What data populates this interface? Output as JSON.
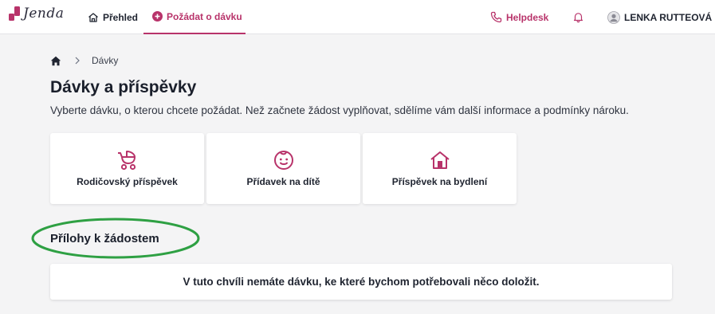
{
  "header": {
    "logo_text": "Jenda",
    "nav": {
      "overview": "Přehled",
      "request_benefit": "Požádat o dávku",
      "helpdesk": "Helpdesk",
      "user_name": "LENKA RUTTEOVÁ"
    }
  },
  "breadcrumb": {
    "current": "Dávky"
  },
  "page": {
    "title": "Dávky a příspěvky",
    "description": "Vyberte dávku, o kterou chcete požádat. Než začnete žádost vyplňovat, sdělíme vám další informace a podmínky nároku."
  },
  "benefits": [
    {
      "label": "Rodičovský příspěvek",
      "icon": "stroller-icon"
    },
    {
      "label": "Přídavek na dítě",
      "icon": "child-face-icon"
    },
    {
      "label": "Příspěvek na bydlení",
      "icon": "house-icon"
    }
  ],
  "attachments": {
    "title": "Přílohy k žádostem",
    "empty_message": "V tuto chvíli nemáte dávku, ke které bychom potřebovali něco doložit."
  },
  "colors": {
    "accent": "#b8336a",
    "background": "#f4f4f5",
    "annotation": "#2ea043"
  }
}
